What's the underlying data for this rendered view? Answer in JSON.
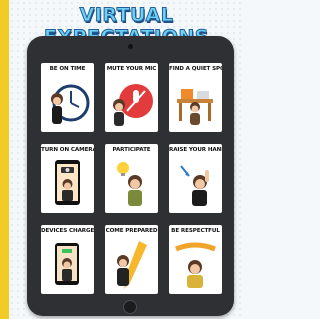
{
  "title": "VIRTUAL EXPECTATIONS",
  "colors": {
    "accent_border": "#f3cb26",
    "title_fill": "#6fd0f2",
    "title_stroke": "#1f5f9a",
    "tablet": "#2e3033",
    "card": "#ffffff"
  },
  "cards": [
    {
      "label": "BE ON TIME",
      "icon": "clock-icon"
    },
    {
      "label": "MUTE YOUR MIC",
      "icon": "muted-mic-icon"
    },
    {
      "label": "FIND A QUIET SPOT",
      "icon": "desk-icon"
    },
    {
      "label": "TURN ON CAMERA",
      "icon": "camera-icon"
    },
    {
      "label": "PARTICIPATE",
      "icon": "lightbulb-icon"
    },
    {
      "label": "RAISE YOUR HAND",
      "icon": "raised-hand-icon"
    },
    {
      "label": "DEVICES CHARGED",
      "icon": "charged-device-icon"
    },
    {
      "label": "COME PREPARED",
      "icon": "pencil-icon"
    },
    {
      "label": "BE RESPECTFUL",
      "icon": "respect-banner-icon"
    }
  ]
}
